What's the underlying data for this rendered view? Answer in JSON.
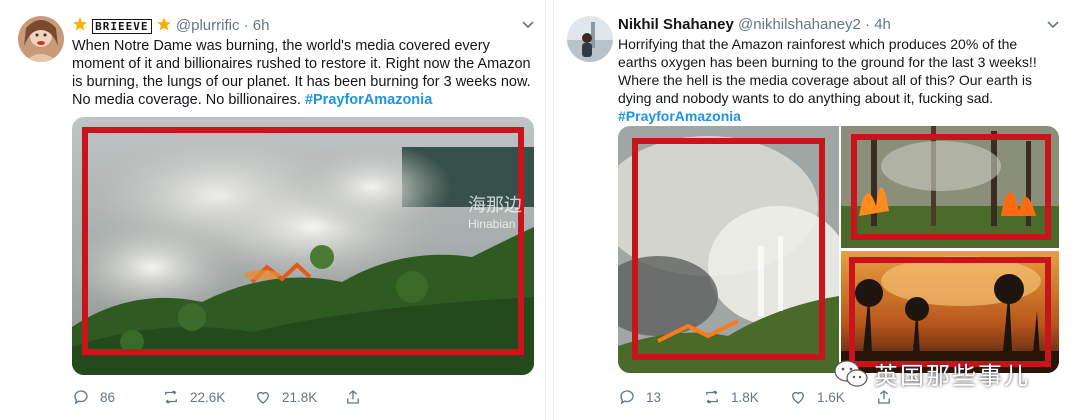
{
  "tweet1": {
    "display_name_badge": "BRIEEVE",
    "handle": "@plurrific",
    "time": "6h",
    "text": "When Notre Dame was burning, the world's media covered every moment of it and billionaires rushed to restore it. Right now the Amazon is burning, the lungs of our planet. It has been burning for 3 weeks now. No media coverage. No billionaires.",
    "hashtag": "#PrayforAmazonia",
    "watermark_cn": "海那边",
    "watermark_en": "Hinabian",
    "replies": "86",
    "retweets": "22.6K",
    "likes": "21.8K"
  },
  "tweet2": {
    "name": "Nikhil Shahaney",
    "handle": "@nikhilshahaney2",
    "time": "4h",
    "text": "Horrifying that the Amazon rainforest which produces 20% of the earths oxygen has been burning to the ground for the last 3 weeks!! Where the hell is the media coverage about all of this? Our earth is dying and nobody wants to do anything about it, fucking sad.",
    "hashtag": "#PrayforAmazonia",
    "replies": "13",
    "retweets": "1.8K",
    "likes": "1.6K"
  },
  "corner_watermark": "英国那些事儿",
  "colors": {
    "highlight_box": "#c8151b",
    "hashtag": "#1b95e0",
    "muted": "#657786"
  }
}
